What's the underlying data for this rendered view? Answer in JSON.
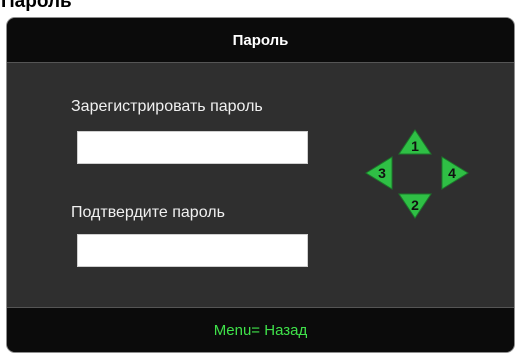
{
  "window_title": "Пароль",
  "dialog": {
    "title": "Пароль",
    "register_label": "Зарегистрировать пароль",
    "register_value": "",
    "confirm_label": "Подтвердите пароль",
    "confirm_value": "",
    "footer_hint": "Menu= Назад"
  },
  "arrow_keys": {
    "up": "1",
    "down": "2",
    "left": "3",
    "right": "4"
  },
  "colors": {
    "accent_green": "#3fe24a",
    "arrow_fill": "#2fbf45",
    "dialog_bg": "#2f2f2f",
    "header_bg": "#0b0b0b"
  }
}
